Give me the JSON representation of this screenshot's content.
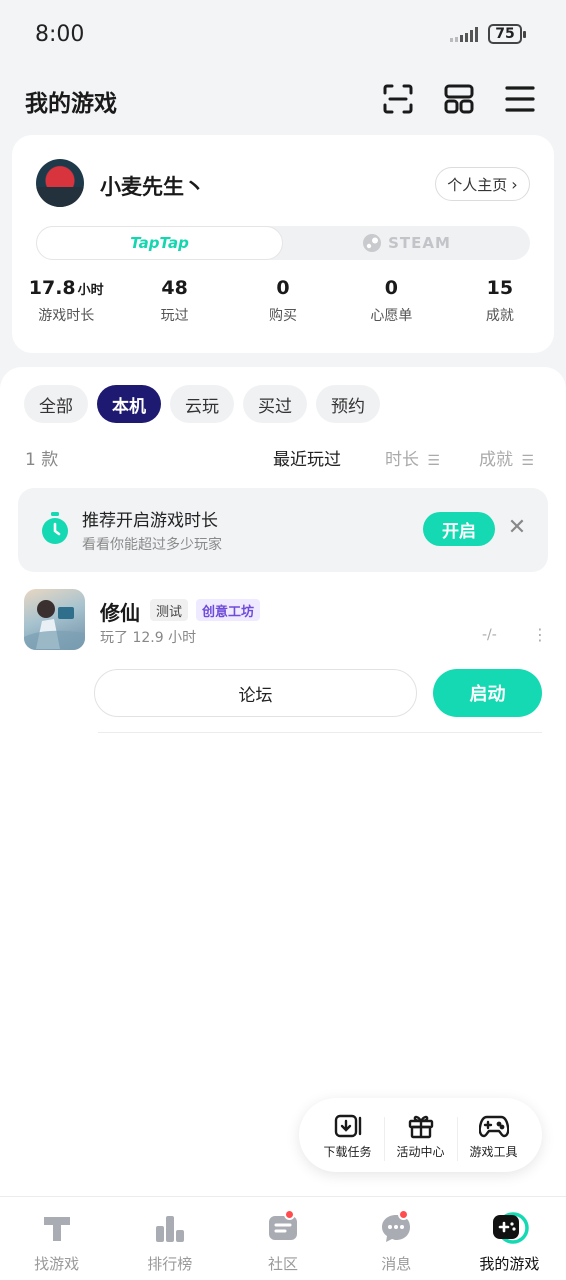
{
  "status_bar": {
    "time": "8:00",
    "battery": "75"
  },
  "header": {
    "title": "我的游戏",
    "icons": [
      "scan-icon",
      "grid-icon",
      "menu-icon"
    ]
  },
  "profile": {
    "username": "小麦先生丶",
    "home_button": "个人主页",
    "platforms": [
      "TapTap",
      "STEAM"
    ],
    "stats": [
      {
        "value": "17.8",
        "unit": "小时",
        "label": "游戏时长"
      },
      {
        "value": "48",
        "unit": "",
        "label": "玩过"
      },
      {
        "value": "0",
        "unit": "",
        "label": "购买"
      },
      {
        "value": "0",
        "unit": "",
        "label": "心愿单"
      },
      {
        "value": "15",
        "unit": "",
        "label": "成就"
      }
    ]
  },
  "filters": {
    "tabs": [
      "全部",
      "本机",
      "云玩",
      "买过",
      "预约"
    ],
    "active": "本机"
  },
  "list": {
    "count": "1 款",
    "sort": {
      "recent": "最近玩过",
      "time": "时长",
      "achievement": "成就"
    }
  },
  "promo": {
    "title": "推荐开启游戏时长",
    "subtitle": "看看你能超过多少玩家",
    "button": "开启"
  },
  "games": [
    {
      "name": "修仙",
      "tags": [
        "测试",
        "创意工坊"
      ],
      "played": "玩了 12.9 小时",
      "score": "-/-",
      "forum_button": "论坛",
      "launch_button": "启动"
    }
  ],
  "floating_tools": [
    "下载任务",
    "活动中心",
    "游戏工具"
  ],
  "bottom_nav": {
    "items": [
      "找游戏",
      "排行榜",
      "社区",
      "消息",
      "我的游戏"
    ],
    "active": "我的游戏"
  },
  "colors": {
    "accent": "#15d9b2",
    "active_chip": "#1e1a72",
    "badge": "#ff4d4f",
    "workshop_tag": "#6e4bd8"
  }
}
